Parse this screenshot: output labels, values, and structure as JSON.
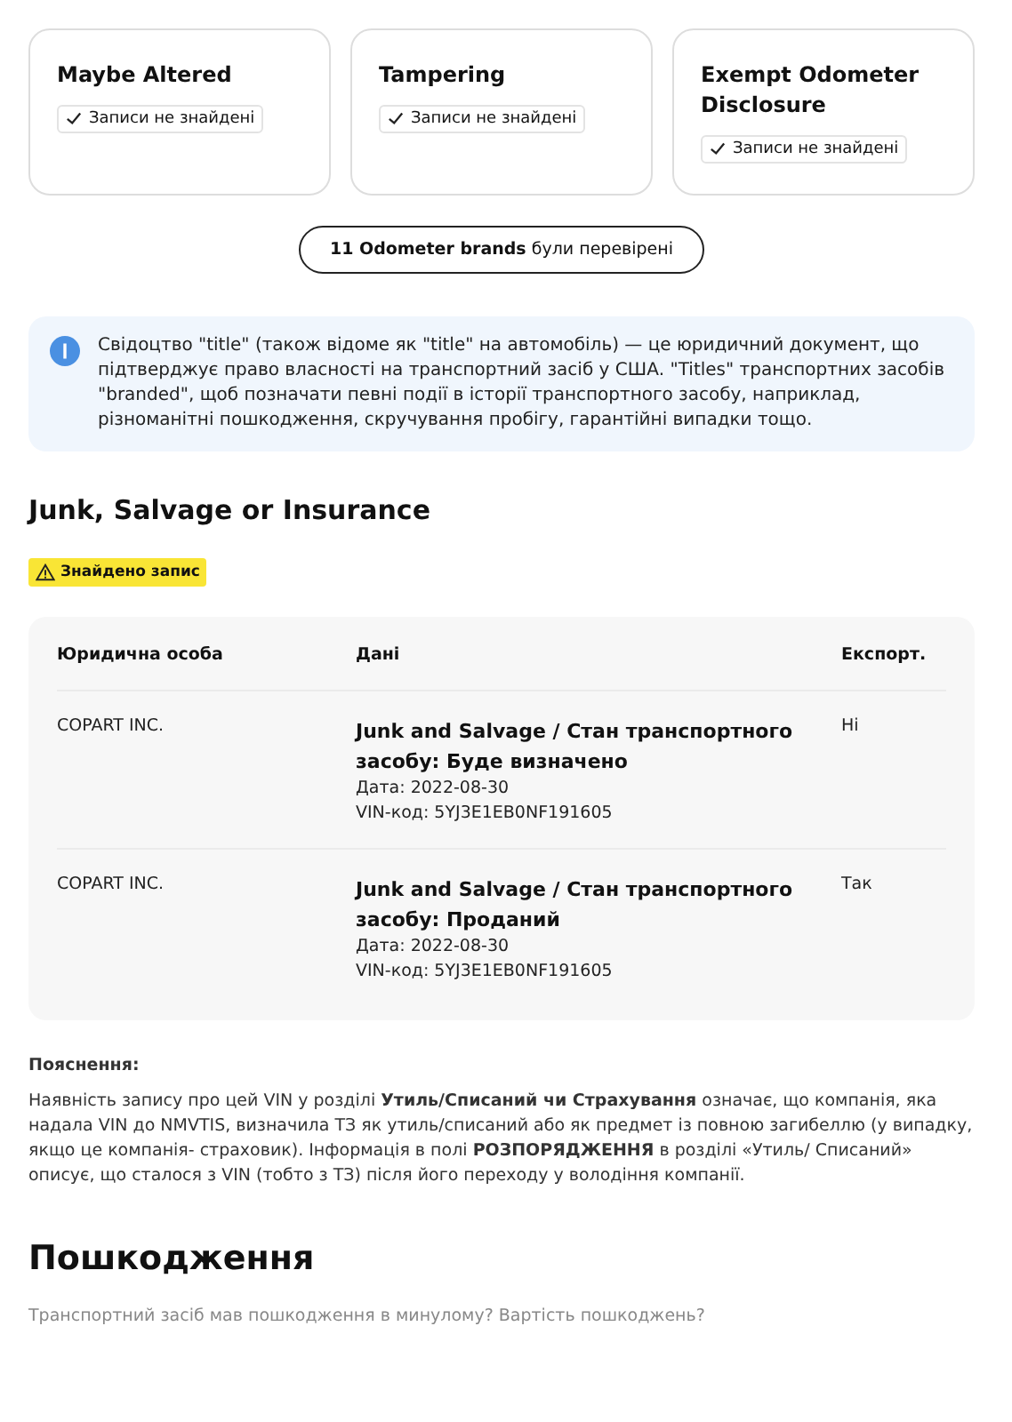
{
  "cards": [
    {
      "title": "Maybe Altered",
      "status": "Записи не знайдені"
    },
    {
      "title": "Tampering",
      "status": "Записи не знайдені"
    },
    {
      "title": "Exempt Odometer Disclosure",
      "status": "Записи не знайдені"
    }
  ],
  "brands_pill": "**11 Odometer brands** були перевірені",
  "info": "Свідоцтво \"title\" (також відоме як \"title\" на автомобіль) — це юридичний документ, що підтверджує право власності на транспортний засіб у США. \"Titles\" транспортних засобів \"branded\", щоб позначати певні події в історії транспортного засобу, наприклад, різноманітні пошкодження, скручування пробігу, гарантійні випадки тощо.",
  "section": {
    "title": "Junk, Salvage or Insurance",
    "badge": "Знайдено запис"
  },
  "table": {
    "columns": [
      "Юридична особа",
      "Дані",
      "Експорт."
    ],
    "rows": [
      {
        "entity": "COPART INC.",
        "title": "Junk and Salvage / Стан транспортного засобу: Буде визначено",
        "date": "Дата: 2022-08-30",
        "vin": "VIN-код: 5YJ3E1EB0NF191605",
        "export": "Ні"
      },
      {
        "entity": "COPART INC.",
        "title": "Junk and Salvage / Стан транспортного засобу: Проданий",
        "date": "Дата: 2022-08-30",
        "vin": "VIN-код: 5YJ3E1EB0NF191605",
        "export": "Так"
      }
    ]
  },
  "explanation": {
    "heading": "Пояснення:",
    "text": "Наявність запису про цей VIN у розділі **Утиль/Списаний чи Страхування** означає, що компанія, яка надала VIN до NMVTIS, визначила ТЗ як утиль/списаний або як предмет із повною загибеллю (у випадку, якщо це компанія- страховик). Інформація в полі **РОЗПОРЯДЖЕННЯ** в розділі «Утиль/ Списаний» описує, що сталося з VIN (тобто з ТЗ) після його переходу у володіння компанії."
  },
  "damage": {
    "title": "Пошкодження",
    "subtitle": "Транспортний засіб мав пошкодження в минулому? Вартість пошкоджень?"
  }
}
